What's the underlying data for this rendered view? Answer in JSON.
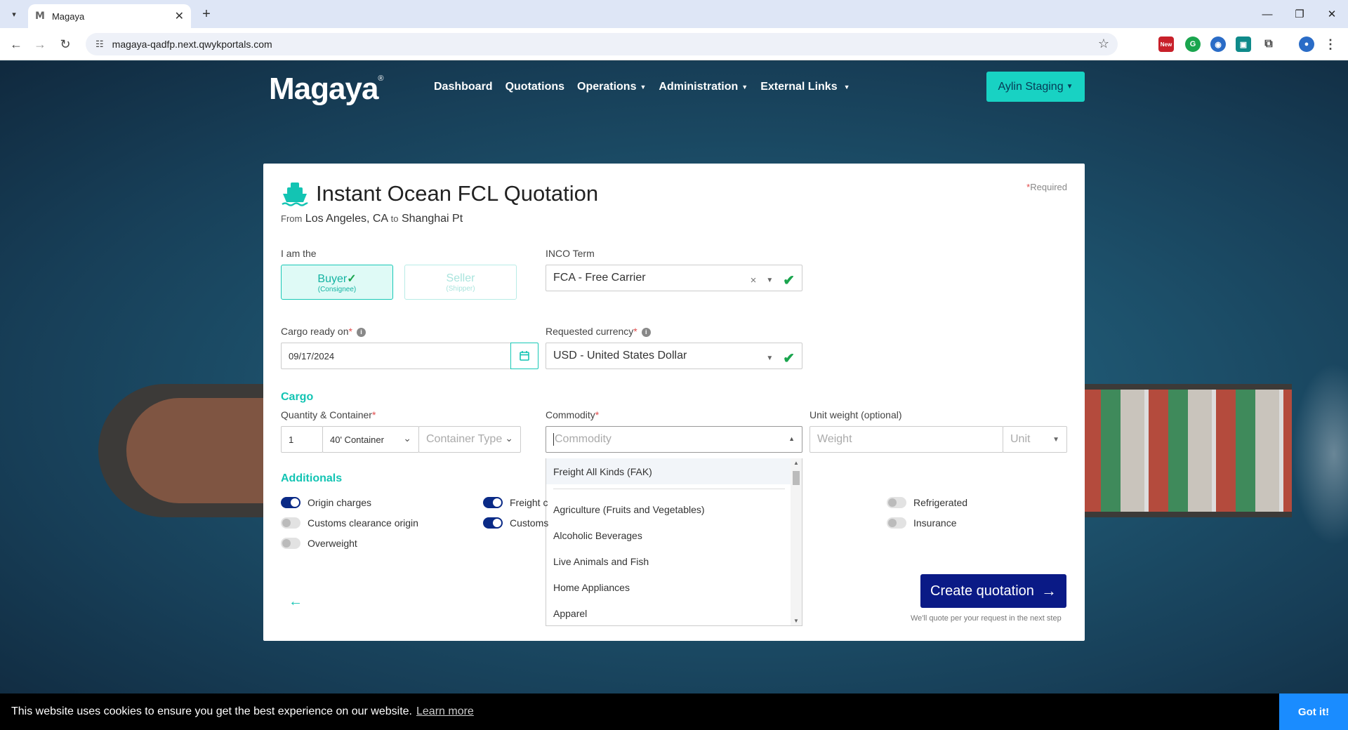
{
  "browser": {
    "tab_title": "Magaya",
    "tab_favicon": "M",
    "url": "magaya-qadfp.next.qwykportals.com",
    "ext_badge": "New"
  },
  "nav": {
    "logo": "Magaya",
    "logo_reg": "®",
    "items": [
      {
        "label": "Dashboard",
        "has_caret": false
      },
      {
        "label": "Quotations",
        "has_caret": false
      },
      {
        "label": "Operations",
        "has_caret": true
      },
      {
        "label": "Administration",
        "has_caret": true
      },
      {
        "label": "External Links",
        "has_caret": true
      }
    ],
    "user": "Aylin Staging"
  },
  "card": {
    "title": "Instant Ocean FCL Quotation",
    "required_star": "*",
    "required_note": "Required",
    "route_from_label": "From",
    "route_from": "Los Angeles, CA",
    "route_to_label": "to",
    "route_to": "Shanghai Pt",
    "role_label": "I am the",
    "buyer": {
      "main": "Buyer",
      "sub": "(Consignee)",
      "selected": true
    },
    "seller": {
      "main": "Seller",
      "sub": "(Shipper)",
      "selected": false
    },
    "inco_label": "INCO Term",
    "inco_value": "FCA - Free Carrier",
    "cargo_ready_label": "Cargo ready on",
    "cargo_ready_value": "09/17/2024",
    "currency_label": "Requested currency",
    "currency_value": "USD - United States Dollar",
    "cargo_section": "Cargo",
    "qty_label": "Quantity & Container",
    "qty_value": "1",
    "container_size": "40' Container",
    "container_type_placeholder": "Container Type",
    "commodity_label": "Commodity",
    "commodity_placeholder": "Commodity",
    "unit_weight_label": "Unit weight (optional)",
    "weight_placeholder": "Weight",
    "unit_placeholder": "Unit",
    "commodity_options_pinned": "Freight All Kinds (FAK)",
    "commodity_options": [
      "Agriculture (Fruits and Vegetables)",
      "Alcoholic Beverages",
      "Live Animals and Fish",
      "Home Appliances",
      "Apparel"
    ],
    "additionals_section": "Additionals",
    "additionals": {
      "origin_charges": {
        "label": "Origin charges",
        "on": true
      },
      "customs_origin": {
        "label": "Customs clearance origin",
        "on": false
      },
      "overweight": {
        "label": "Overweight",
        "on": false
      },
      "freight": {
        "label": "Freight c",
        "on": true
      },
      "customs": {
        "label": "Customs",
        "on": true
      },
      "refrigerated": {
        "label": "Refrigerated",
        "on": false
      },
      "insurance": {
        "label": "Insurance",
        "on": false
      }
    },
    "create_button": "Create quotation",
    "create_note": "We'll quote per your request in the next step"
  },
  "cookie": {
    "message": "This website uses cookies to ensure you get the best experience on our website.",
    "learn_more": "Learn more",
    "got_it": "Got it!"
  },
  "colors": {
    "accent": "#13c4b3",
    "primary": "#0a1a86",
    "success": "#1aa54e"
  }
}
